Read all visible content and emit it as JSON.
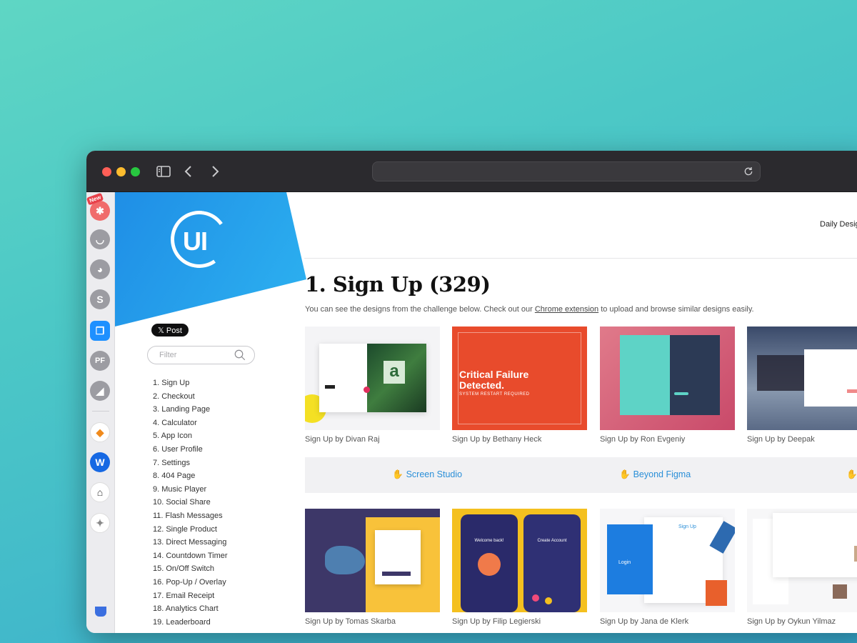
{
  "dock": {
    "new_badge": "New",
    "items": [
      "icon-burst",
      "icon-pocket",
      "icon-palette",
      "icon-s",
      "icon-copy",
      "icon-pf",
      "icon-mountain",
      "icon-fish",
      "icon-webflow",
      "icon-robot",
      "icon-sparkle",
      "icon-shield"
    ]
  },
  "sidebar": {
    "logo_text": "UI",
    "post_button": "𝕏 Post",
    "filter_placeholder": "Filter",
    "categories": [
      "1. Sign Up",
      "2. Checkout",
      "3. Landing Page",
      "4. Calculator",
      "5. App Icon",
      "6. User Profile",
      "7. Settings",
      "8. 404 Page",
      "9. Music Player",
      "10. Social Share",
      "11. Flash Messages",
      "12. Single Product",
      "13. Direct Messaging",
      "14. Countdown Timer",
      "15. On/Off Switch",
      "16. Pop-Up / Overlay",
      "17. Email Receipt",
      "18. Analytics Chart",
      "19. Leaderboard"
    ]
  },
  "header": {
    "top_link": "Daily Desig"
  },
  "main": {
    "title": "1. Sign Up (329)",
    "subtext_before": "You can see the designs from the challenge below. Check out our ",
    "subtext_link": "Chrome extension",
    "subtext_after": " to upload and browse similar designs easily.",
    "row1": [
      {
        "caption": "Sign Up by Divan Raj"
      },
      {
        "caption": "Sign Up by Bethany Heck",
        "art_title": "Critical Failure Detected.",
        "art_sub": "SYSTEM RESTART REQUIRED"
      },
      {
        "caption": "Sign Up by Ron Evgeniy"
      },
      {
        "caption": "Sign Up by Deepak"
      }
    ],
    "sponsors": [
      "Screen Studio",
      "Beyond Figma"
    ],
    "row2": [
      {
        "caption": "Sign Up by Tomas Skarba"
      },
      {
        "caption": "Sign Up by Filip Legierski",
        "art_title": "Welcome back!",
        "art_sub": "Create Account"
      },
      {
        "caption": "Sign Up by Jana de Klerk",
        "art_title": "Sign Up",
        "art_sub": "Login"
      },
      {
        "caption": "Sign Up by Oykun Yilmaz"
      }
    ]
  },
  "colors": {
    "accent": "#2a8fd8",
    "banner": "#1f8ee6",
    "brand_red": "#e84b2c"
  }
}
